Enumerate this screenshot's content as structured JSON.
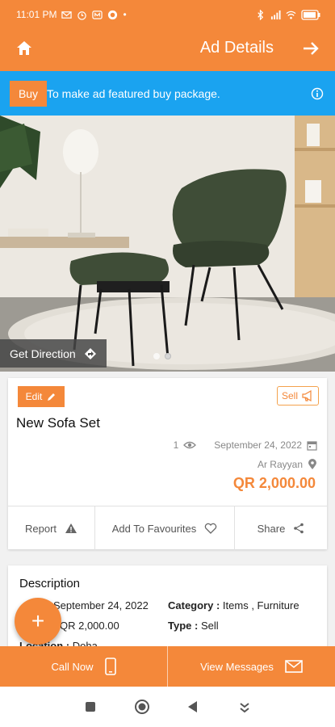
{
  "status_bar": {
    "time": "11:01 PM",
    "dot": "•"
  },
  "app_bar": {
    "title": "Ad Details"
  },
  "featured": {
    "buy_label": "Buy",
    "message": "To make ad featured buy package."
  },
  "hero": {
    "get_direction_label": "Get Direction",
    "slides": 2,
    "active_slide": 2
  },
  "ad": {
    "edit_label": "Edit",
    "type_badge": "Sell",
    "title": "New Sofa Set",
    "views": "1",
    "date": "September 24, 2022",
    "location": "Ar Rayyan",
    "price": "QR 2,000.00",
    "actions": {
      "report": "Report",
      "favourites": "Add To Favourites",
      "share": "Share"
    }
  },
  "description": {
    "title": "Description",
    "date_value": "September 24, 2022",
    "price_value": "QR 2,000.00",
    "category_label": "Category :",
    "category_value": "Items , Furniture",
    "type_label": "Type :",
    "type_value": "Sell",
    "location_label": "Location :",
    "location_value": "Doha"
  },
  "fab": {
    "label": "+"
  },
  "bottom": {
    "call_now": "Call Now",
    "view_messages": "View Messages"
  },
  "colors": {
    "brand": "#f4883a",
    "info_bar": "#1aa3f0"
  },
  "icons": [
    "home-icon",
    "arrow-right-icon",
    "info-icon",
    "direction-icon",
    "pencil-icon",
    "megaphone-icon",
    "eye-icon",
    "calendar-icon",
    "location-pin-icon",
    "warning-icon",
    "heart-icon",
    "share-icon",
    "phone-icon",
    "mail-icon"
  ]
}
